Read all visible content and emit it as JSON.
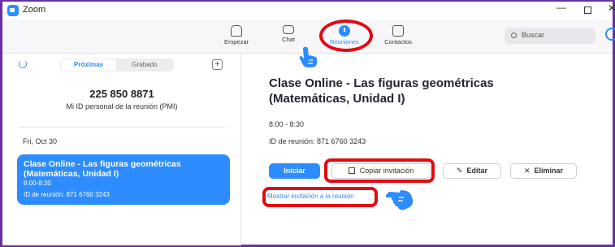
{
  "window": {
    "title": "Zoom"
  },
  "toolbar": {
    "tabs": [
      {
        "label": "Empezar",
        "icon": "home-icon"
      },
      {
        "label": "Chat",
        "icon": "chat-icon"
      },
      {
        "label": "Reuniones",
        "icon": "clock-icon",
        "active": true
      },
      {
        "label": "Contactos",
        "icon": "contacts-icon"
      }
    ],
    "search_placeholder": "Buscar"
  },
  "sidebar": {
    "segments": {
      "active": "Próximas",
      "inactive": "Grabado"
    },
    "pmi_number": "225 850 8871",
    "pmi_label": "Mi ID personal de la reunión (PMI)",
    "date_header": "Fri, Oct 30",
    "meeting_card": {
      "title": "Clase Online - Las figuras geométricas (Matemáticas, Unidad I)",
      "time": "8:00-8:30",
      "id_line": "ID de reunión: 871 6760 3243"
    }
  },
  "details": {
    "title": "Clase Online - Las figuras geométricas (Matemáticas, Unidad I)",
    "time": "8:00 - 8:30",
    "meeting_id": "ID de reunión: 871 6760 3243",
    "buttons": {
      "start": "Iniciar",
      "copy": "Copiar invitación",
      "edit": "Editar",
      "delete": "Eliminar"
    },
    "show_invitation": "Mostrar invitación a la reunión"
  },
  "colors": {
    "accent": "#2d8cff",
    "highlight": "#e20a12",
    "frame": "#6a2fa3"
  }
}
